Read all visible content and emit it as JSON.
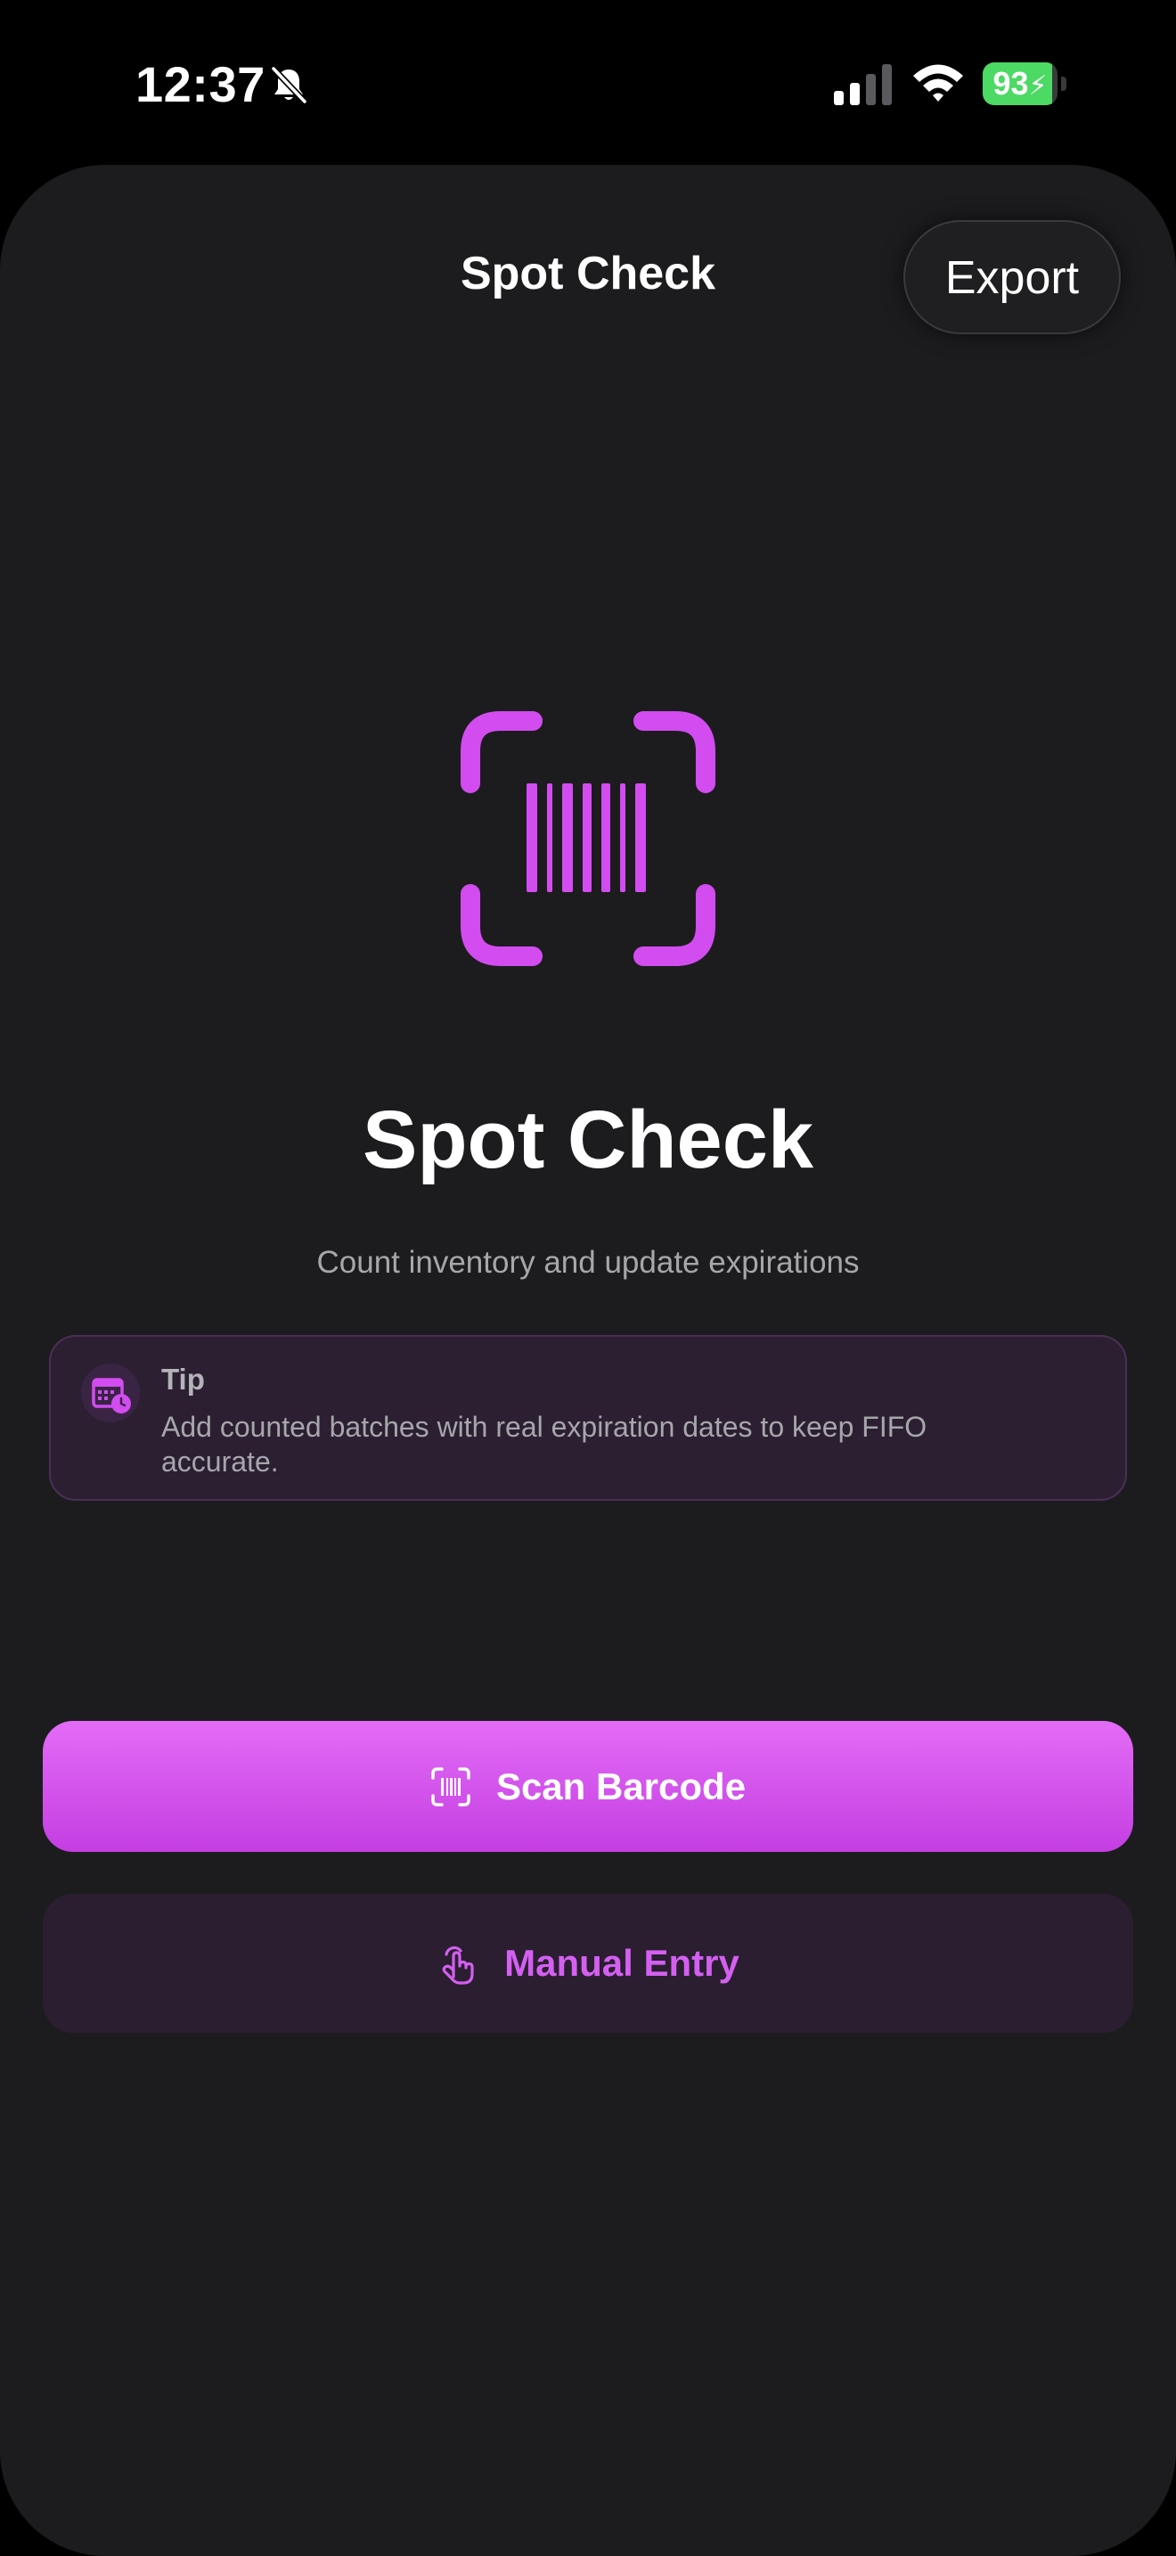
{
  "status_bar": {
    "time": "12:37",
    "battery_level": "93",
    "battery_percent": 93,
    "icons": [
      "bell-slash-icon",
      "cellular-signal-icon",
      "wifi-icon",
      "battery-charging-icon"
    ]
  },
  "nav": {
    "title": "Spot Check",
    "export_label": "Export"
  },
  "hero": {
    "icon": "barcode-viewfinder-icon",
    "title": "Spot Check",
    "subtitle": "Count inventory and update expirations"
  },
  "tip": {
    "icon": "calendar-clock-icon",
    "heading": "Tip",
    "body": "Add counted batches with real expiration dates to keep FIFO accurate."
  },
  "actions": {
    "scan": {
      "label": "Scan Barcode",
      "icon": "barcode-viewfinder-icon"
    },
    "manual": {
      "label": "Manual Entry",
      "icon": "hand-tap-icon"
    }
  },
  "colors": {
    "accent": "#d24cf0",
    "accent_gradient_top": "#e36cf6",
    "accent_gradient_bottom": "#c43ee2",
    "background": "#1c1c1e",
    "tip_background": "#2b1f31",
    "battery_green": "#4cd964"
  }
}
